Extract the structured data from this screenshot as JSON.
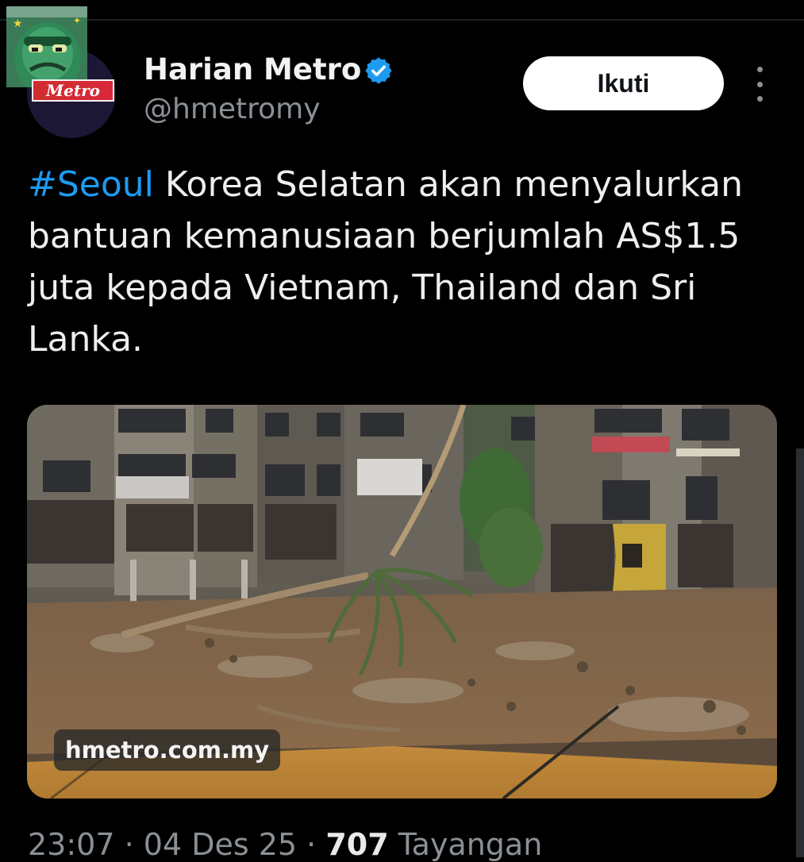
{
  "author": {
    "display_name": "Harian Metro",
    "handle": "@hmetromy",
    "avatar_logo_text": "Metro",
    "verified_icon": "verified-badge-icon"
  },
  "actions": {
    "follow_label": "Ikuti",
    "more_icon": "more-options-icon"
  },
  "tweet": {
    "hashtag": "#Seoul",
    "line1_rest": " Korea Selatan akan menyalurkan",
    "line2": "bantuan kemanusiaan berjumlah AS$1.5",
    "line3": "juta kepada Vietnam, Thailand dan Sri",
    "line4": "Lanka."
  },
  "media": {
    "watermark": "hmetro.com.my"
  },
  "meta": {
    "time": "23:07",
    "sep1": " · ",
    "date": "04 Des 25",
    "sep2": " · ",
    "views_count": "707",
    "views_label": " Tayangan"
  },
  "colors": {
    "background": "#000000",
    "hashtag": "#1d9bf0",
    "verified": "#1d9bf0",
    "follow_button": "#ffffff",
    "secondary_text": "#8b9096"
  }
}
